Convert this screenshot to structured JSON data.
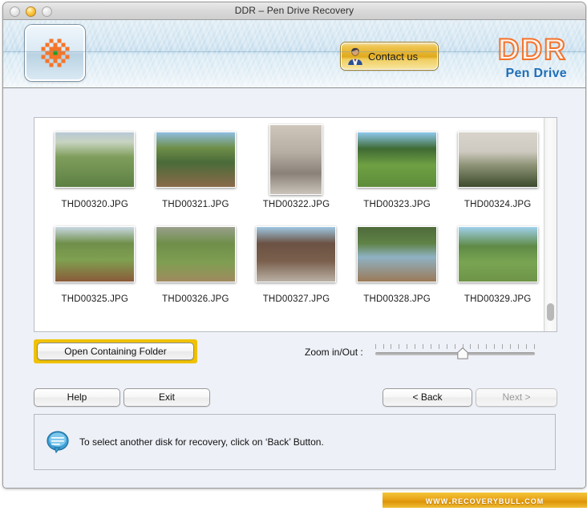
{
  "window": {
    "title": "DDR – Pen Drive Recovery",
    "traffic_lights": [
      "close-button",
      "minimize-button",
      "zoom-button"
    ]
  },
  "banner": {
    "logo_icon": "ddr-checker-logo-icon",
    "contact_button": {
      "label": "Contact us",
      "icon": "person-avatar-icon"
    },
    "brand_title": "DDR",
    "brand_subtitle": "Pen Drive"
  },
  "thumbnails": {
    "rows": [
      [
        {
          "name": "THD00320.JPG",
          "orientation": "landscape"
        },
        {
          "name": "THD00321.JPG",
          "orientation": "landscape"
        },
        {
          "name": "THD00322.JPG",
          "orientation": "portrait"
        },
        {
          "name": "THD00323.JPG",
          "orientation": "landscape"
        },
        {
          "name": "THD00324.JPG",
          "orientation": "landscape"
        }
      ],
      [
        {
          "name": "THD00325.JPG",
          "orientation": "landscape"
        },
        {
          "name": "THD00326.JPG",
          "orientation": "landscape"
        },
        {
          "name": "THD00327.JPG",
          "orientation": "landscape"
        },
        {
          "name": "THD00328.JPG",
          "orientation": "landscape"
        },
        {
          "name": "THD00329.JPG",
          "orientation": "landscape"
        }
      ]
    ],
    "scrollbar": "vertical-scrollbar"
  },
  "controls": {
    "open_folder_label": "Open Containing Folder",
    "zoom_label": "Zoom in/Out :",
    "zoom_tick_count": 21,
    "zoom_value_percent": 55,
    "help_label": "Help",
    "exit_label": "Exit",
    "back_label": "< Back",
    "next_label": "Next >",
    "next_disabled": true
  },
  "status": {
    "icon": "speech-bubble-icon",
    "message": "To select another disk for recovery, click on ‘Back’ Button."
  },
  "watermark": {
    "text": "www.recoverybull.com"
  },
  "colors": {
    "accent_gold": "#f0c200",
    "brand_orange": "#f4732a",
    "brand_blue": "#1f6fb8",
    "panel_bg": "#eef1f8"
  }
}
